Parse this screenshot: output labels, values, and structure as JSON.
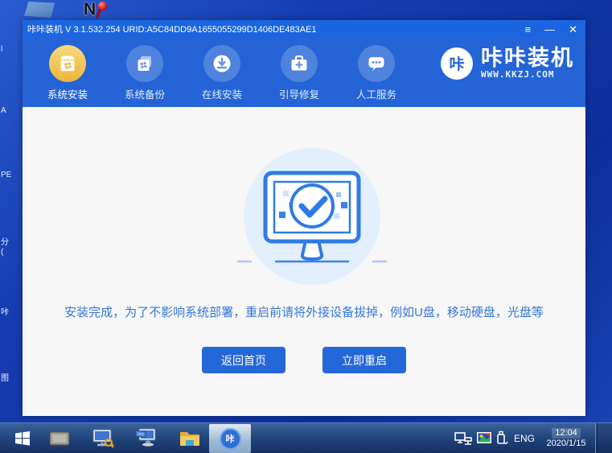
{
  "desktop": {
    "edge_labels": [
      "l",
      "A",
      "PE",
      "分\n(",
      "咔",
      "图"
    ],
    "top_icons": [
      "laptop-icon",
      "n-red-key-icon"
    ]
  },
  "window": {
    "title": "咔咔装机 V 3.1.532.254 URID:A5C84DD9A1655055299D1406DE483AE1",
    "controls": {
      "menu": "≡",
      "minimize": "—",
      "close": "✕"
    },
    "nav": [
      {
        "label": "系统安装",
        "icon": "package-icon",
        "active": true
      },
      {
        "label": "系统备份",
        "icon": "backup-copies-icon",
        "active": false
      },
      {
        "label": "在线安装",
        "icon": "download-circle-icon",
        "active": false
      },
      {
        "label": "引导修复",
        "icon": "toolbox-icon",
        "active": false
      },
      {
        "label": "人工服务",
        "icon": "chat-bubble-icon",
        "active": false
      }
    ],
    "logo": {
      "badge": "咔",
      "name": "咔咔装机",
      "site": "WWW.KKZJ.COM"
    },
    "main": {
      "illustration": "monitor-check-icon",
      "message": "安装完成，为了不影响系统部署，重启前请将外接设备拔掉，例如U盘，移动硬盘，光盘等",
      "home_button": "返回首页",
      "restart_button": "立即重启"
    }
  },
  "taskbar": {
    "start_icon": "windows-logo-icon",
    "app_icons": [
      "chip-icon",
      "monitor-lock-icon",
      "pc-keyboard-icon",
      "folder-icon",
      "kaka-app-icon"
    ],
    "app_badge": "咔",
    "tray_icons": [
      "network-icon",
      "display-color-icon",
      "usb-eject-icon"
    ],
    "language": "ENG",
    "time": "12:04",
    "date": "2020/1/15"
  },
  "colors": {
    "desktop": "#16 3db0",
    "titlebar": "#1b66e0",
    "navbar": "#2464d6",
    "active_nav": "#ecb43a",
    "button": "#2367d9",
    "message_text": "#3577d4",
    "illustration_stroke": "#2e7be5",
    "illustration_bg": "#e4effd"
  }
}
